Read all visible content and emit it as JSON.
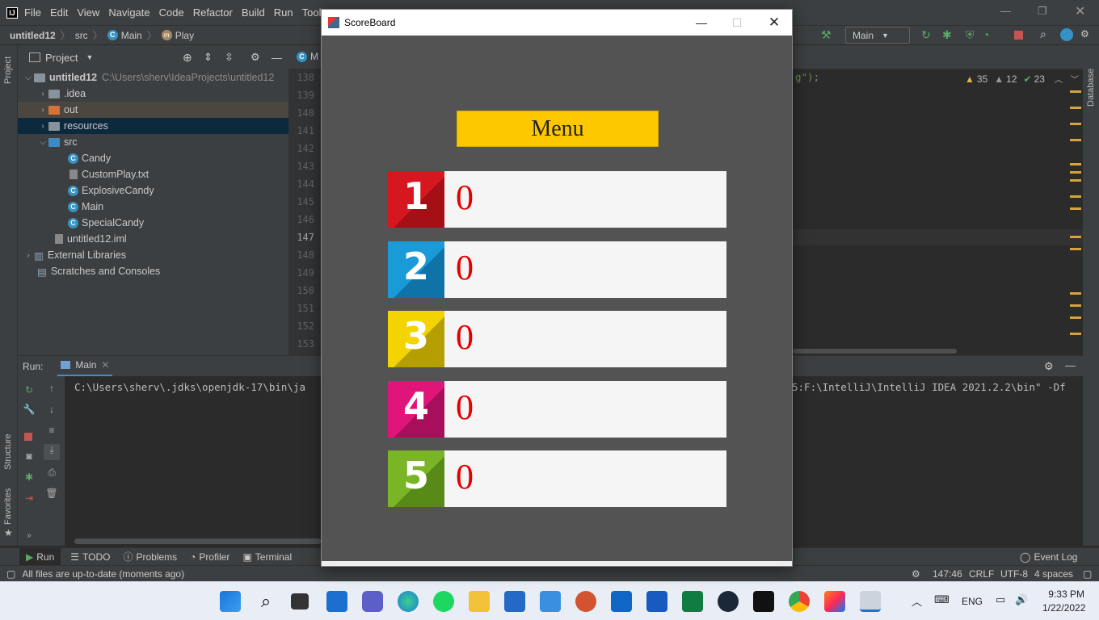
{
  "menubar": {
    "logo": "IJ",
    "items": [
      "File",
      "Edit",
      "View",
      "Navigate",
      "Code",
      "Refactor",
      "Build",
      "Run",
      "Tools"
    ]
  },
  "navbar": {
    "crumbs": [
      "untitled12",
      "src",
      "Main",
      "Play"
    ],
    "run_config": "Main"
  },
  "project": {
    "header": "Project",
    "tree": [
      {
        "label": "untitled12",
        "path": "C:\\Users\\sherv\\IdeaProjects\\untitled12"
      },
      {
        "label": ".idea"
      },
      {
        "label": "out"
      },
      {
        "label": "resources"
      },
      {
        "label": "src"
      },
      {
        "label": "Candy"
      },
      {
        "label": "CustomPlay.txt"
      },
      {
        "label": "ExplosiveCandy"
      },
      {
        "label": "Main"
      },
      {
        "label": "SpecialCandy"
      },
      {
        "label": "untitled12.iml"
      },
      {
        "label": "External Libraries"
      },
      {
        "label": "Scratches and Consoles"
      }
    ]
  },
  "editor": {
    "tab": "M",
    "line_numbers": [
      "138",
      "139",
      "140",
      "141",
      "142",
      "143",
      "144",
      "145",
      "146",
      "147",
      "148",
      "149",
      "150",
      "151",
      "152",
      "153"
    ],
    "code_fragment": "g\");",
    "warnings": "35",
    "weak_warnings": "12",
    "ok": "23"
  },
  "side_tabs": {
    "project": "Project",
    "structure": "Structure",
    "favorites": "Favorites",
    "database": "Database"
  },
  "run": {
    "label": "Run:",
    "tab": "Main",
    "console_left": "C:\\Users\\sherv\\.jdks\\openjdk-17\\bin\\ja",
    "console_right": "5:F:\\IntelliJ\\IntelliJ IDEA 2021.2.2\\bin\" -Df"
  },
  "bottom_tabs": [
    "Run",
    "TODO",
    "Problems",
    "Profiler",
    "Terminal"
  ],
  "event_log": "Event Log",
  "status": {
    "message": "All files are up-to-date (moments ago)",
    "position": "147:46",
    "line_sep": "CRLF",
    "encoding": "UTF-8",
    "indent": "4 spaces"
  },
  "scoreboard": {
    "title": "ScoreBoard",
    "menu_button": "Menu",
    "rows": [
      {
        "rank": "1",
        "score": "0",
        "color": "#d6171f",
        "dark": "#a50f16"
      },
      {
        "rank": "2",
        "score": "0",
        "color": "#1a9ad6",
        "dark": "#0f73a8"
      },
      {
        "rank": "3",
        "score": "0",
        "color": "#f3d400",
        "dark": "#b59e00"
      },
      {
        "rank": "4",
        "score": "0",
        "color": "#e0157a",
        "dark": "#a80f5a"
      },
      {
        "rank": "5",
        "score": "0",
        "color": "#7ab527",
        "dark": "#578a16"
      }
    ]
  },
  "taskbar": {
    "lang": "ENG",
    "time": "9:33 PM",
    "date": "1/22/2022"
  }
}
